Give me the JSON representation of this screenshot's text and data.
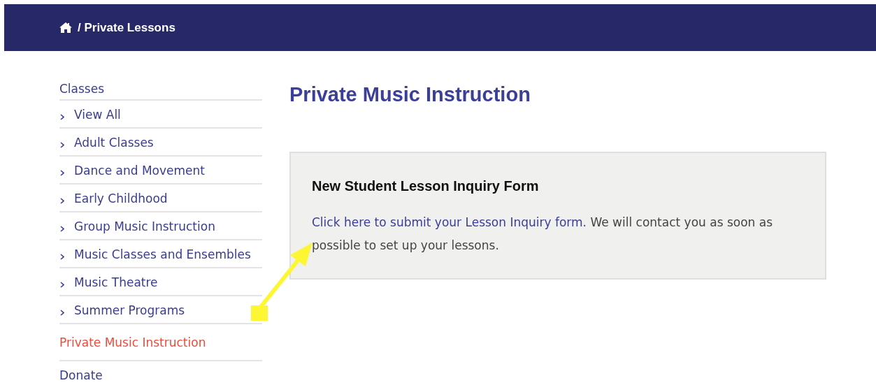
{
  "breadcrumb": {
    "current": "/ Private Lessons"
  },
  "sidebar": {
    "items": [
      {
        "label": "Classes",
        "kind": "top",
        "selected": false
      },
      {
        "label": "View All",
        "kind": "sub",
        "selected": false
      },
      {
        "label": "Adult Classes",
        "kind": "sub",
        "selected": false
      },
      {
        "label": "Dance and Movement",
        "kind": "sub",
        "selected": false
      },
      {
        "label": "Early Childhood",
        "kind": "sub",
        "selected": false
      },
      {
        "label": "Group Music Instruction",
        "kind": "sub",
        "selected": false
      },
      {
        "label": "Music Classes and Ensembles",
        "kind": "sub",
        "selected": false
      },
      {
        "label": "Music Theatre",
        "kind": "sub",
        "selected": false
      },
      {
        "label": "Summer Programs",
        "kind": "sub",
        "selected": false
      },
      {
        "label": "Private Music Instruction",
        "kind": "top",
        "selected": true
      },
      {
        "label": "Donate",
        "kind": "top",
        "selected": false
      }
    ]
  },
  "page_title": "Private Music Instruction",
  "card": {
    "title": "New Student Lesson Inquiry Form",
    "link": "Click here to submit your Lesson Inquiry form.",
    "text": " We will contact you as soon as possible to set up your lessons."
  }
}
